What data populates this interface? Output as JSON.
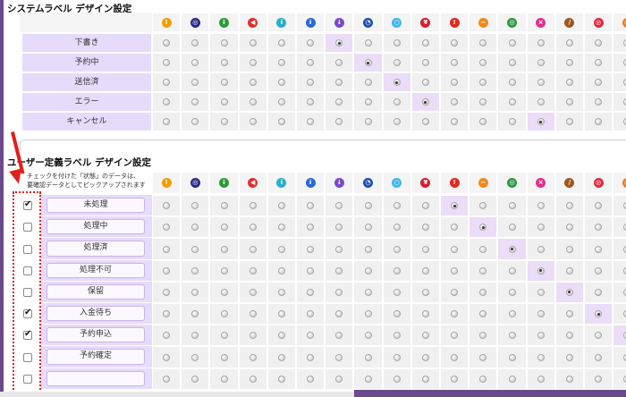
{
  "system_section": {
    "title": "システムラベル デザイン設定",
    "rows": [
      {
        "label": "下書き",
        "selected": 6
      },
      {
        "label": "予約中",
        "selected": 7
      },
      {
        "label": "送信済",
        "selected": 8
      },
      {
        "label": "エラー",
        "selected": 9
      },
      {
        "label": "キャンセル",
        "selected": 13
      }
    ]
  },
  "user_section": {
    "title": "ユーザー定義ラベル デザイン設定",
    "note_line1": "チェックを付けた「状態」のデータは、",
    "note_line2": "要確認データとしてピックアップされます",
    "rows": [
      {
        "label": "未処理",
        "checked": true,
        "selected": 10
      },
      {
        "label": "処理中",
        "checked": false,
        "selected": 11
      },
      {
        "label": "処理済",
        "checked": false,
        "selected": 12
      },
      {
        "label": "処理不可",
        "checked": false,
        "selected": 13
      },
      {
        "label": "保留",
        "checked": false,
        "selected": 14
      },
      {
        "label": "入金待ち",
        "checked": true,
        "selected": 15
      },
      {
        "label": "予約申込",
        "checked": true,
        "selected": 16
      },
      {
        "label": "予約確定",
        "checked": false,
        "selected": -1
      },
      {
        "label": "",
        "checked": false,
        "selected": -1
      }
    ]
  },
  "icons": [
    {
      "name": "exclaim-icon",
      "glyph": "!",
      "color": "#f0a000"
    },
    {
      "name": "target-navy-icon",
      "glyph": "◎",
      "color": "#2a2a8a"
    },
    {
      "name": "info-green-icon",
      "glyph": "i",
      "color": "#2e9a3a"
    },
    {
      "name": "arrow-red-icon",
      "glyph": "◀",
      "color": "#e03030"
    },
    {
      "name": "info-teal-icon",
      "glyph": "i",
      "color": "#28b0c8"
    },
    {
      "name": "info-blue-icon",
      "glyph": "i",
      "color": "#2a6ad0"
    },
    {
      "name": "download-purple-icon",
      "glyph": "↓",
      "color": "#7a4ac8"
    },
    {
      "name": "clock-icon",
      "glyph": "◔",
      "color": "#2050b0"
    },
    {
      "name": "ring-cyan-icon",
      "glyph": "○",
      "color": "#40b8e8"
    },
    {
      "name": "mark-red-icon",
      "glyph": "¥",
      "color": "#d02030"
    },
    {
      "name": "alert-red-icon",
      "glyph": "!",
      "color": "#e02a20"
    },
    {
      "name": "minus-orange-icon",
      "glyph": "−",
      "color": "#f08a20"
    },
    {
      "name": "target-green-icon",
      "glyph": "◎",
      "color": "#2a9a40"
    },
    {
      "name": "close-pink-icon",
      "glyph": "×",
      "color": "#e0308a"
    },
    {
      "name": "pencil-icon",
      "glyph": "/",
      "color": "#9a5a20"
    },
    {
      "name": "target-red-icon",
      "glyph": "◎",
      "color": "#e02a40"
    },
    {
      "name": "target-orange-icon",
      "glyph": "◎",
      "color": "#f07a20"
    }
  ],
  "colors": {
    "frame": "#6b4a8c",
    "label_bg": "#e7dbfb",
    "selected_cell": "#ebdcf7",
    "annotation_red": "#e0201a"
  }
}
